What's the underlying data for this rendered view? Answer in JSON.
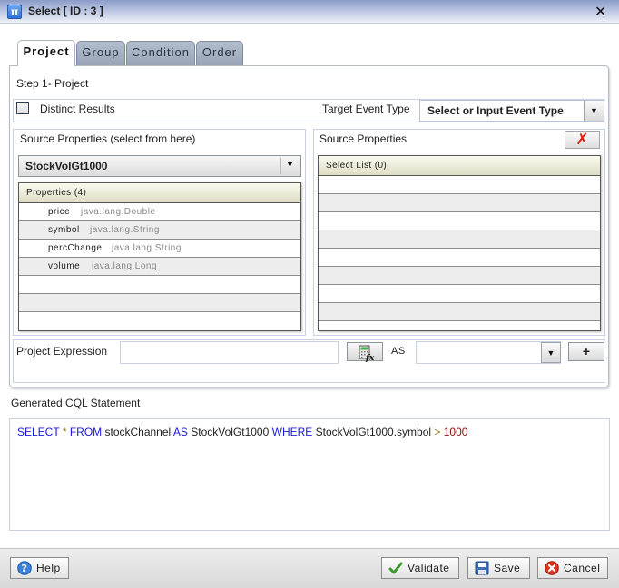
{
  "window": {
    "title": "Select [ ID : 3 ]",
    "app_icon": "pi-icon",
    "close_icon": "close-icon"
  },
  "tabs": [
    {
      "label": "Project",
      "active": true
    },
    {
      "label": "Group",
      "active": false
    },
    {
      "label": "Condition",
      "active": false
    },
    {
      "label": "Order",
      "active": false
    }
  ],
  "project": {
    "step_label": "Step 1- Project",
    "distinct_label": "Distinct Results",
    "distinct_checked": false,
    "target_event_type_label": "Target Event Type",
    "target_event_type_value": "Select or Input Event Type",
    "source_left": {
      "title": "Source Properties (select from here)",
      "selected_source": "StockVolGt1000",
      "table_header": "Properties (4)",
      "rows": [
        {
          "name": "price",
          "type": "java.lang.Double"
        },
        {
          "name": "symbol",
          "type": "java.lang.String"
        },
        {
          "name": "percChange",
          "type": "java.lang.String"
        },
        {
          "name": "volume",
          "type": "java.lang.Long"
        }
      ]
    },
    "source_right": {
      "title": "Source Properties",
      "table_header": "Select List (0)",
      "clear_icon": "red-x-icon"
    },
    "expression": {
      "label": "Project Expression",
      "value": "",
      "as_label": "AS",
      "alias_value": "",
      "plus_label": "+"
    }
  },
  "cql": {
    "label": "Generated CQL Statement",
    "tokens": [
      {
        "t": "SELECT",
        "c": "kw"
      },
      {
        "t": " ",
        "c": ""
      },
      {
        "t": "*",
        "c": "op"
      },
      {
        "t": " ",
        "c": ""
      },
      {
        "t": "FROM",
        "c": "kw"
      },
      {
        "t": " stockChannel ",
        "c": ""
      },
      {
        "t": "AS",
        "c": "kw"
      },
      {
        "t": " StockVolGt1000 ",
        "c": ""
      },
      {
        "t": "WHERE",
        "c": "kw"
      },
      {
        "t": " StockVolGt1000.symbol ",
        "c": ""
      },
      {
        "t": ">",
        "c": "op"
      },
      {
        "t": " ",
        "c": ""
      },
      {
        "t": "1000",
        "c": "num"
      }
    ]
  },
  "footer": {
    "help_label": "Help",
    "validate_label": "Validate",
    "save_label": "Save",
    "cancel_label": "Cancel"
  }
}
